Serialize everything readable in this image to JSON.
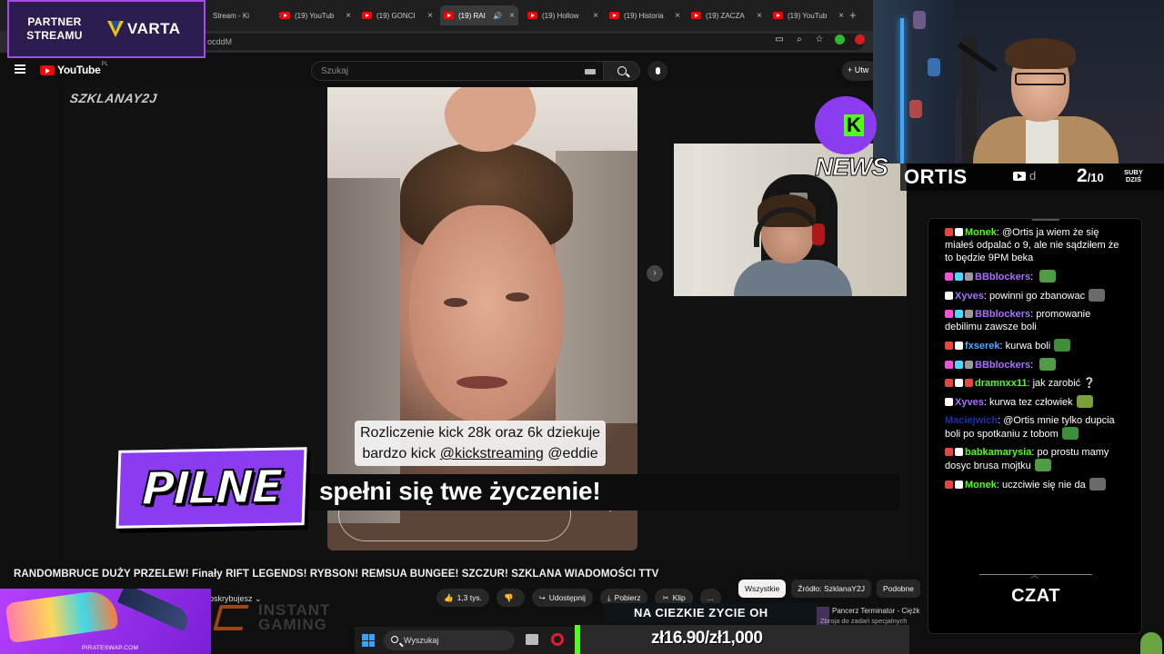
{
  "browser": {
    "tabs": [
      {
        "label": "Stream - Ki",
        "has_yt": false,
        "active": false
      },
      {
        "label": "(19) YouTub",
        "has_yt": true,
        "active": false
      },
      {
        "label": "(19) GONCI",
        "has_yt": true,
        "active": false
      },
      {
        "label": "(19) RAI",
        "has_yt": true,
        "active": true
      },
      {
        "label": "(19) Hollow",
        "has_yt": true,
        "active": false
      },
      {
        "label": "(19) Historia",
        "has_yt": true,
        "active": false
      },
      {
        "label": "(19) ZACZA",
        "has_yt": true,
        "active": false
      },
      {
        "label": "(19) YouTub",
        "has_yt": true,
        "active": false
      }
    ],
    "tab_close": "×",
    "new_tab": "+",
    "url_fragment": "ocddM"
  },
  "youtube": {
    "logo_text": "YouTube",
    "logo_region": "PL",
    "search_placeholder": "Szukaj",
    "create_label": "Utw",
    "watermark": "SZKLANAY2J",
    "story_caption_line1": "Rozliczenie kick 28k oraz 6k dziekuje",
    "story_caption_line2_pre": "bardzo kick ",
    "story_caption_link": "@kickstreaming",
    "story_caption_mention": " @eddie",
    "pilne": "PILNE",
    "ticker": "spełni się twe życzenie!",
    "video_title": "RANDOMBRUCE DUŻY PRZELEW! Finały RIFT LEGENDS! RYBSON! REMSUA BUNGEE! SZCZUR! SZKLANA WIADOMOŚCI TTV",
    "subscribe_partial": "oskrybujesz",
    "like_count": "1,3 tys.",
    "share_label": "Udostępnij",
    "download_label": "Pobierz",
    "clip_label": "Klip",
    "more_label": "...",
    "chips": [
      "Wszystkie",
      "Źródło: SzklanaY2J",
      "Podobne"
    ],
    "suggestion_title": "Pancerz Terminator - Ciężk",
    "suggestion_sub": "Zbroja do zadań specjalnych"
  },
  "overlay": {
    "partner_line1": "PARTNER",
    "partner_line2": "STREAMU",
    "brand": "VARTA",
    "news_label": "NEWS",
    "streamer": "ORTIS",
    "yt_suffix": "d",
    "sub_current": "2",
    "sub_goal": "/10",
    "subs_label_1": "SUBY",
    "subs_label_2": "DZIŚ",
    "kick_banner": "NA CIEZKIE ZYCIE OH",
    "donation": "zł16.90/zł1,000",
    "pirate_url": "PIRATESWAP.COM",
    "instant_line1": "INSTANT",
    "instant_line2": "GAMING",
    "chat_title": "CZAT"
  },
  "taskbar": {
    "search_label": "Wyszukaj"
  },
  "chat": {
    "messages": [
      {
        "badges": [
          "#e8463d",
          "#ffffff"
        ],
        "user": "Monek",
        "color": "#53fc18",
        "text": "@Ortis ja wiem że się miałeś odpalać o 9, ale nie sądziłem że to będzie 9PM beka",
        "emote": false
      },
      {
        "badges": [
          "#ff4fd8",
          "#4fd8ff",
          "#9a9a9a"
        ],
        "user": "BBblockers",
        "color": "#a970ff",
        "text": "",
        "emote": true
      },
      {
        "badges": [
          "#ffffff"
        ],
        "user": "Xyves",
        "color": "#a970ff",
        "text": "powinni go zbanowac",
        "emote": true
      },
      {
        "badges": [
          "#ff4fd8",
          "#4fd8ff",
          "#9a9a9a"
        ],
        "user": "BBblockers",
        "color": "#a970ff",
        "text": "promowanie debilimu zawsze boli",
        "emote": false
      },
      {
        "badges": [
          "#e8463d",
          "#ffffff"
        ],
        "user": "fxserek",
        "color": "#4fa8ff",
        "text": "kurwa boli",
        "emote": true
      },
      {
        "badges": [
          "#ff4fd8",
          "#4fd8ff",
          "#9a9a9a"
        ],
        "user": "BBblockers",
        "color": "#a970ff",
        "text": "",
        "emote": true
      },
      {
        "badges": [
          "#e8463d",
          "#ffffff",
          "#e8463d"
        ],
        "user": "dramnxx11",
        "color": "#53fc18",
        "text": "jak zarobić ❔",
        "emote": false
      },
      {
        "badges": [
          "#ffffff"
        ],
        "user": "Xyves",
        "color": "#a970ff",
        "text": "kurwa tez człowiek",
        "emote": true
      },
      {
        "badges": [],
        "user": "Maciejwich",
        "color": "#1e2fa8",
        "text": "@Ortis mnie tylko dupcia boli po spotkaniu z tobom",
        "emote": true
      },
      {
        "badges": [
          "#e8463d",
          "#ffffff"
        ],
        "user": "babkamarysia",
        "color": "#53fc18",
        "text": "po prostu mamy dosyc brusa mojtku",
        "emote": true
      },
      {
        "badges": [
          "#e8463d",
          "#ffffff"
        ],
        "user": "Monek",
        "color": "#53fc18",
        "text": "uczciwie się nie da",
        "emote": true
      }
    ]
  }
}
